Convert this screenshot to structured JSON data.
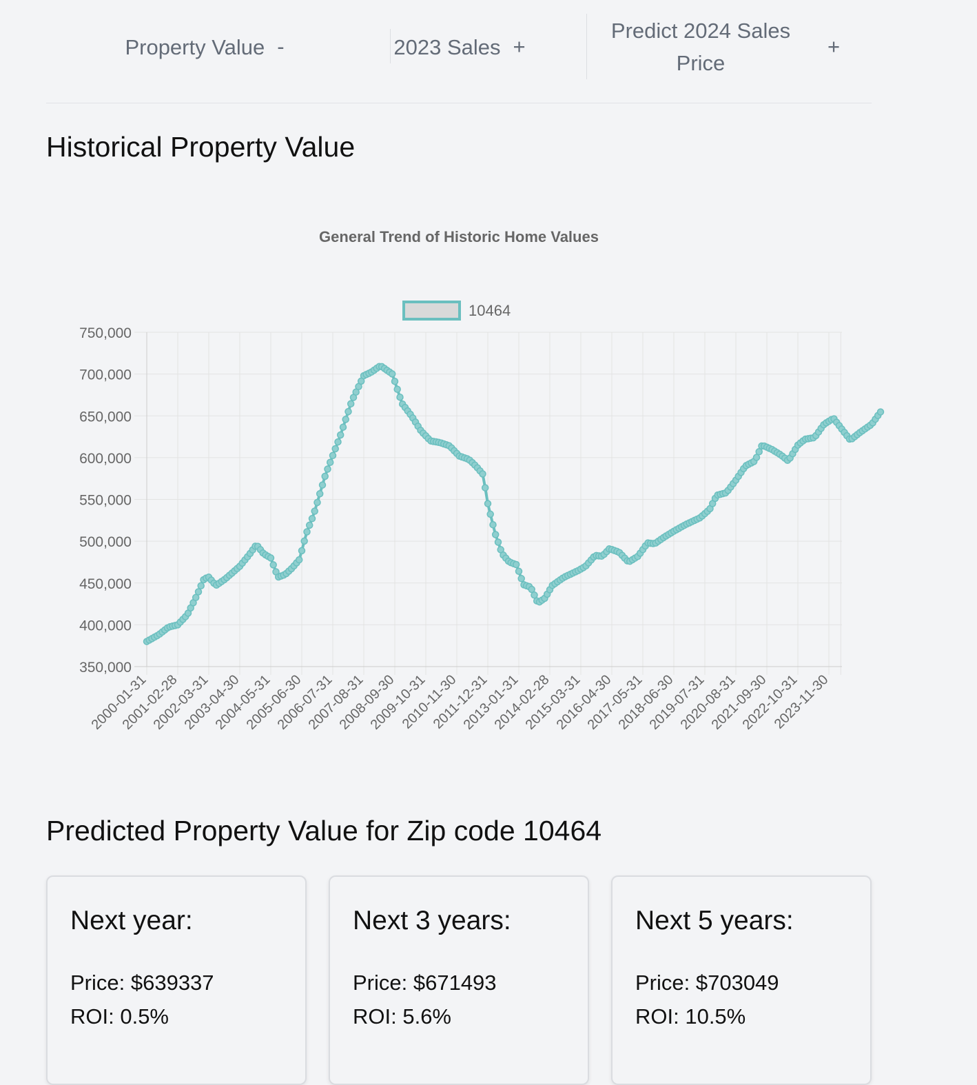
{
  "tabs": [
    {
      "label": "Property Value",
      "toggle": "-"
    },
    {
      "label": "2023 Sales",
      "toggle": "+"
    },
    {
      "label": "Predict 2024 Sales Price",
      "toggle": "+"
    }
  ],
  "historical_title": "Historical Property Value",
  "predicted_title": "Predicted Property Value for Zip code 10464",
  "predictions": [
    {
      "title": "Next year:",
      "price": "Price: $639337",
      "roi": "ROI: 0.5%"
    },
    {
      "title": "Next 3 years:",
      "price": "Price: $671493",
      "roi": "ROI: 5.6%"
    },
    {
      "title": "Next 5 years:",
      "price": "Price: $703049",
      "roi": "ROI: 10.5%"
    }
  ],
  "colors": {
    "series_line": "#6bbfbf",
    "series_point_fill": "#8fcfcf",
    "legend_fill": "#d9d9d9",
    "grid": "#e3e3e3",
    "axis_text": "#666666"
  },
  "chart_data": {
    "type": "line",
    "title": "General Trend of Historic Home Values",
    "legend_position": "top",
    "grid": true,
    "ylim": [
      350000,
      750000
    ],
    "yticks": [
      750000,
      700000,
      650000,
      600000,
      550000,
      500000,
      450000,
      400000,
      350000
    ],
    "ytick_labels": [
      "750,000",
      "700,000",
      "650,000",
      "600,000",
      "550,000",
      "500,000",
      "450,000",
      "400,000",
      "350,000"
    ],
    "xtick_labels": [
      "2000-01-31",
      "2001-02-28",
      "2002-03-31",
      "2003-04-30",
      "2004-05-31",
      "2005-06-30",
      "2006-07-31",
      "2007-08-31",
      "2008-09-30",
      "2009-10-31",
      "2010-11-30",
      "2011-12-31",
      "2013-01-31",
      "2014-02-28",
      "2015-03-31",
      "2016-04-30",
      "2017-05-31",
      "2018-06-30",
      "2019-07-31",
      "2020-08-31",
      "2021-09-30",
      "2022-10-31",
      "2023-11-30"
    ],
    "x_start": "2000-01-31",
    "x_end": "2024-04-30",
    "series": [
      {
        "name": "10464",
        "anchors": [
          [
            "2000-01-31",
            380000
          ],
          [
            "2000-06-30",
            388000
          ],
          [
            "2000-10-31",
            397000
          ],
          [
            "2001-02-28",
            400000
          ],
          [
            "2001-06-30",
            412000
          ],
          [
            "2001-10-31",
            435000
          ],
          [
            "2002-01-31",
            455000
          ],
          [
            "2002-03-31",
            457000
          ],
          [
            "2002-06-30",
            447000
          ],
          [
            "2002-10-31",
            455000
          ],
          [
            "2003-04-30",
            470000
          ],
          [
            "2003-08-31",
            484000
          ],
          [
            "2003-11-30",
            496000
          ],
          [
            "2004-02-29",
            485000
          ],
          [
            "2004-05-31",
            480000
          ],
          [
            "2004-08-31",
            457000
          ],
          [
            "2004-11-30",
            460000
          ],
          [
            "2005-02-28",
            468000
          ],
          [
            "2005-05-31",
            478000
          ],
          [
            "2005-08-31",
            510000
          ],
          [
            "2005-11-30",
            532000
          ],
          [
            "2006-04-30",
            580000
          ],
          [
            "2006-10-31",
            625000
          ],
          [
            "2007-03-31",
            668000
          ],
          [
            "2007-08-31",
            698000
          ],
          [
            "2007-11-30",
            702000
          ],
          [
            "2008-03-31",
            710000
          ],
          [
            "2008-08-31",
            700000
          ],
          [
            "2008-12-31",
            665000
          ],
          [
            "2009-04-30",
            650000
          ],
          [
            "2009-08-31",
            632000
          ],
          [
            "2009-12-31",
            620000
          ],
          [
            "2010-04-30",
            618000
          ],
          [
            "2010-08-31",
            614000
          ],
          [
            "2010-12-31",
            602000
          ],
          [
            "2011-04-30",
            598000
          ],
          [
            "2011-07-31",
            590000
          ],
          [
            "2011-10-31",
            580000
          ],
          [
            "2011-12-31",
            545000
          ],
          [
            "2012-03-31",
            510000
          ],
          [
            "2012-06-30",
            485000
          ],
          [
            "2012-09-30",
            475000
          ],
          [
            "2012-12-31",
            472000
          ],
          [
            "2013-03-31",
            448000
          ],
          [
            "2013-06-30",
            445000
          ],
          [
            "2013-09-30",
            426000
          ],
          [
            "2013-12-31",
            432000
          ],
          [
            "2014-03-31",
            447000
          ],
          [
            "2014-08-31",
            457000
          ],
          [
            "2015-02-28",
            465000
          ],
          [
            "2015-05-31",
            470000
          ],
          [
            "2015-09-30",
            483000
          ],
          [
            "2015-12-31",
            482000
          ],
          [
            "2016-03-31",
            491000
          ],
          [
            "2016-07-31",
            487000
          ],
          [
            "2016-11-30",
            475000
          ],
          [
            "2017-03-31",
            482000
          ],
          [
            "2017-07-31",
            498000
          ],
          [
            "2017-10-31",
            497000
          ],
          [
            "2018-02-28",
            505000
          ],
          [
            "2018-06-30",
            512000
          ],
          [
            "2018-11-30",
            520000
          ],
          [
            "2019-05-31",
            528000
          ],
          [
            "2019-09-30",
            538000
          ],
          [
            "2019-12-31",
            555000
          ],
          [
            "2020-04-30",
            558000
          ],
          [
            "2020-08-31",
            573000
          ],
          [
            "2020-12-31",
            590000
          ],
          [
            "2021-04-30",
            596000
          ],
          [
            "2021-07-31",
            615000
          ],
          [
            "2021-11-30",
            610000
          ],
          [
            "2022-03-31",
            603000
          ],
          [
            "2022-06-30",
            596000
          ],
          [
            "2022-10-31",
            615000
          ],
          [
            "2023-01-31",
            622000
          ],
          [
            "2023-05-31",
            624000
          ],
          [
            "2023-09-30",
            640000
          ],
          [
            "2024-01-31",
            647000
          ],
          [
            "2024-05-31",
            632000
          ],
          [
            "2024-08-31",
            621000
          ],
          [
            "2024-12-31",
            630000
          ],
          [
            "2025-05-31",
            640000
          ],
          [
            "2025-09-30",
            656000
          ]
        ]
      }
    ]
  }
}
